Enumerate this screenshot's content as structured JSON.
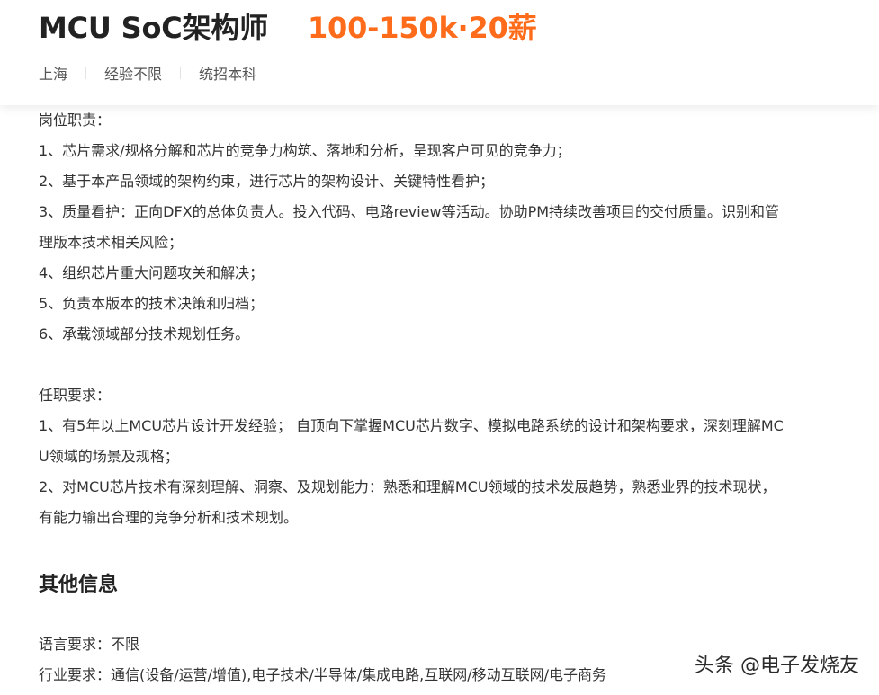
{
  "header": {
    "title": "MCU SoC架构师",
    "salary": "100-150k·20薪",
    "tags": [
      "上海",
      "经验不限",
      "统招本科"
    ]
  },
  "description": {
    "lines": [
      "岗位职责：",
      "1、芯片需求/规格分解和芯片的竞争力构筑、落地和分析，呈现客户可见的竞争力；",
      "2、基于本产品领域的架构约束，进行芯片的架构设计、关键特性看护；",
      "3、质量看护：正向DFX的总体负责人。投入代码、电路review等活动。协助PM持续改善项目的交付质量。识别和管",
      "理版本技术相关风险；",
      "4、组织芯片重大问题攻关和解决；",
      "5、负责本版本的技术决策和归档；",
      "6、承载领域部分技术规划任务。",
      "",
      "任职要求：",
      "1、有5年以上MCU芯片设计开发经验； 自顶向下掌握MCU芯片数字、模拟电路系统的设计和架构要求，深刻理解MC",
      "U领域的场景及规格；",
      "2、对MCU芯片技术有深刻理解、洞察、及规划能力：熟悉和理解MCU领域的技术发展趋势，熟悉业界的技术现状，",
      "有能力输出合理的竞争分析和技术规划。"
    ]
  },
  "other_info": {
    "title": "其他信息",
    "language_label": "语言要求：",
    "language_value": "不限",
    "industry_label": "行业要求：",
    "industry_value": "通信(设备/运营/增值),电子技术/半导体/集成电路,互联网/移动互联网/电子商务"
  },
  "watermark": "头条 @电子发烧友",
  "colors": {
    "salary": "#fe6c1b",
    "title": "#222222",
    "text": "#333333",
    "tag_text": "#555555"
  }
}
